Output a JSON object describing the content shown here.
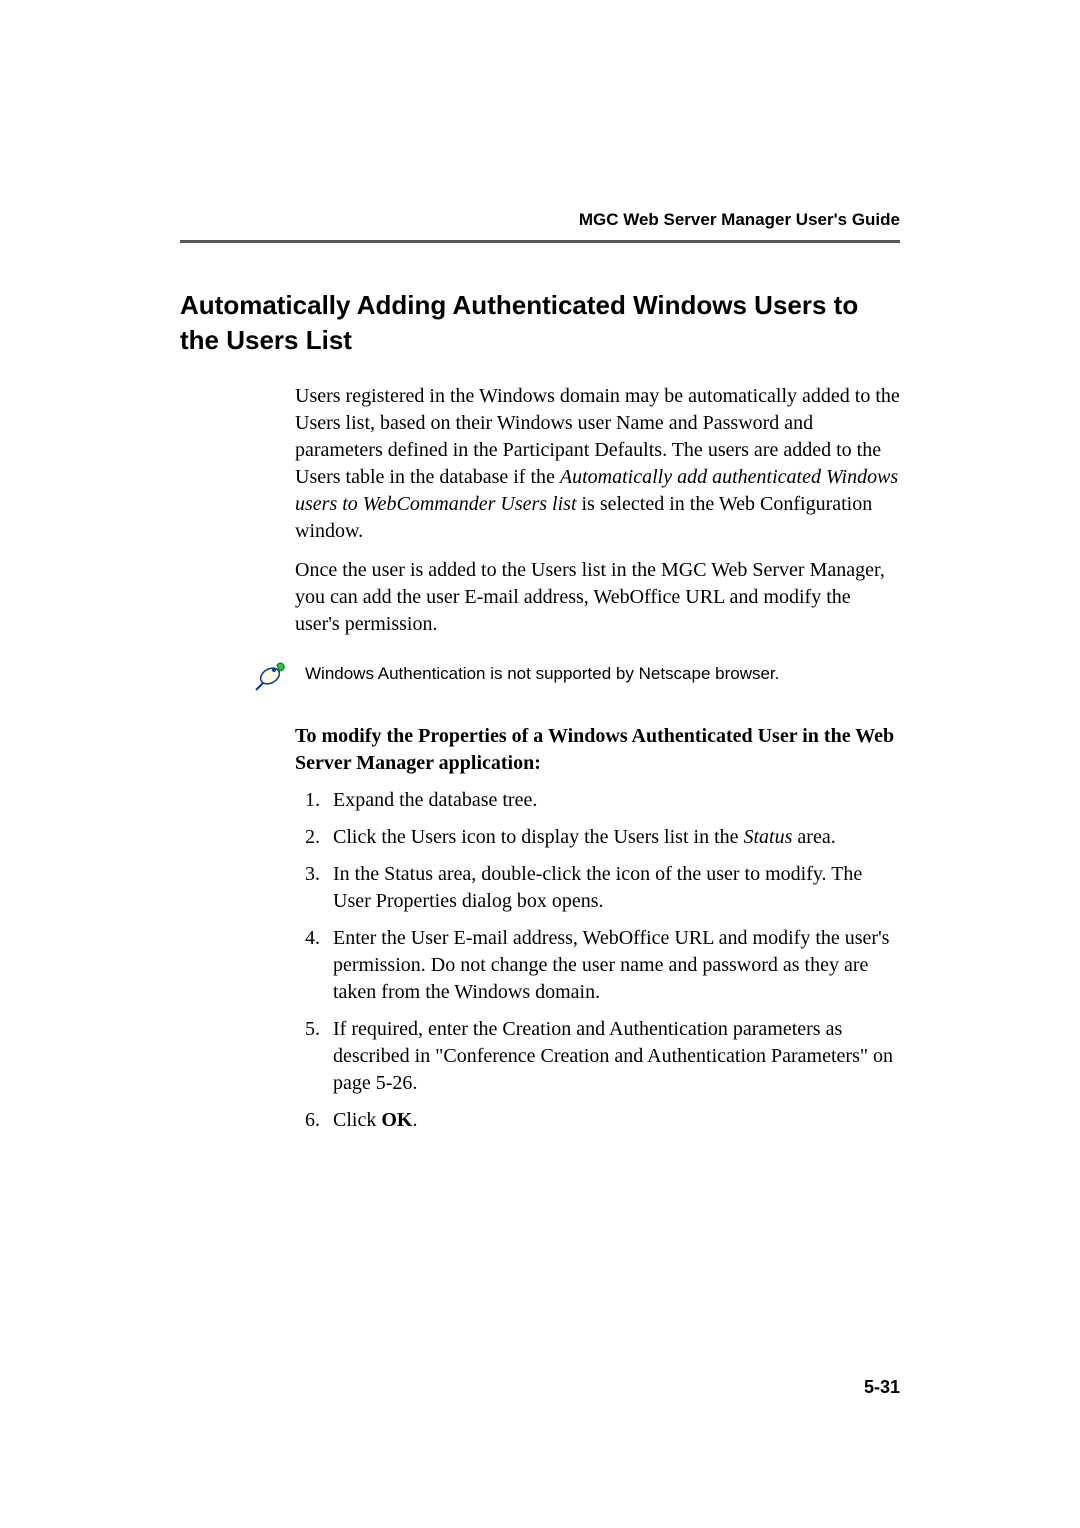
{
  "header": {
    "running_title": "MGC Web Server Manager User's Guide"
  },
  "section": {
    "title": "Automatically Adding Authenticated Windows Users to the Users List"
  },
  "body": {
    "para1_pre": "Users registered in the Windows domain may be automatically added to the Users list, based on their Windows user Name and Password and parameters defined in the Participant Defaults. The users are added to the Users table in the database if the ",
    "para1_italic": "Automatically add authenticated Windows users to WebCommander Users list",
    "para1_post": " is selected in the Web Configuration window.",
    "para2": "Once the user is added to the Users list in the MGC Web Server Manager, you can add the user E-mail address, WebOffice URL and modify the user's permission."
  },
  "note": {
    "text": "Windows Authentication is not supported by Netscape browser."
  },
  "procedure": {
    "subheading": "To modify the Properties of a Windows Authenticated User in the Web Server Manager application:",
    "steps": [
      {
        "text_pre": "Expand the database tree."
      },
      {
        "text_pre": "Click the Users icon to display the Users list in the ",
        "italic": "Status",
        "text_post": " area."
      },
      {
        "text_pre": "In the Status area, double-click the icon of the user to modify. The User Properties dialog box opens."
      },
      {
        "text_pre": "Enter the User E-mail address, WebOffice URL and modify the user's permission. Do not change the user name and password as they are taken from the Windows domain."
      },
      {
        "text_pre": "If required, enter the Creation and Authentication parameters as described in \"Conference Creation and Authentication Parameters\" on page 5-26."
      },
      {
        "text_pre": "Click ",
        "bold": "OK",
        "text_post": "."
      }
    ]
  },
  "footer": {
    "page_number": "5-31"
  }
}
